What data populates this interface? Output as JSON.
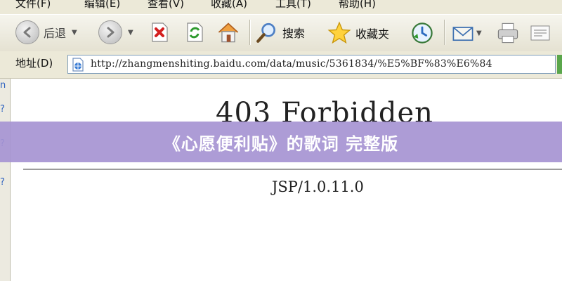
{
  "menu": {
    "items": [
      "文件(F)",
      "编辑(E)",
      "查看(V)",
      "收藏(A)",
      "工具(T)",
      "帮助(H)"
    ]
  },
  "toolbar": {
    "back_label": "后退",
    "search_label": "搜索",
    "favorites_label": "收藏夹"
  },
  "address": {
    "label": "地址(D)",
    "url": "http://zhangmenshiting.baidu.com/data/music/5361834/%E5%BF%83%E6%84"
  },
  "side": {
    "marks": [
      "n",
      "?",
      "?",
      "?"
    ]
  },
  "page": {
    "title": "403 Forbidden",
    "server_signature": "JSP/1.0.11.0"
  },
  "banner": {
    "text": "《心愿便利贴》的歌词 完整版"
  },
  "colors": {
    "banner_bg": "#a694d2",
    "chrome_bg": "#ece9d8",
    "link_blue": "#2a5fbf"
  }
}
